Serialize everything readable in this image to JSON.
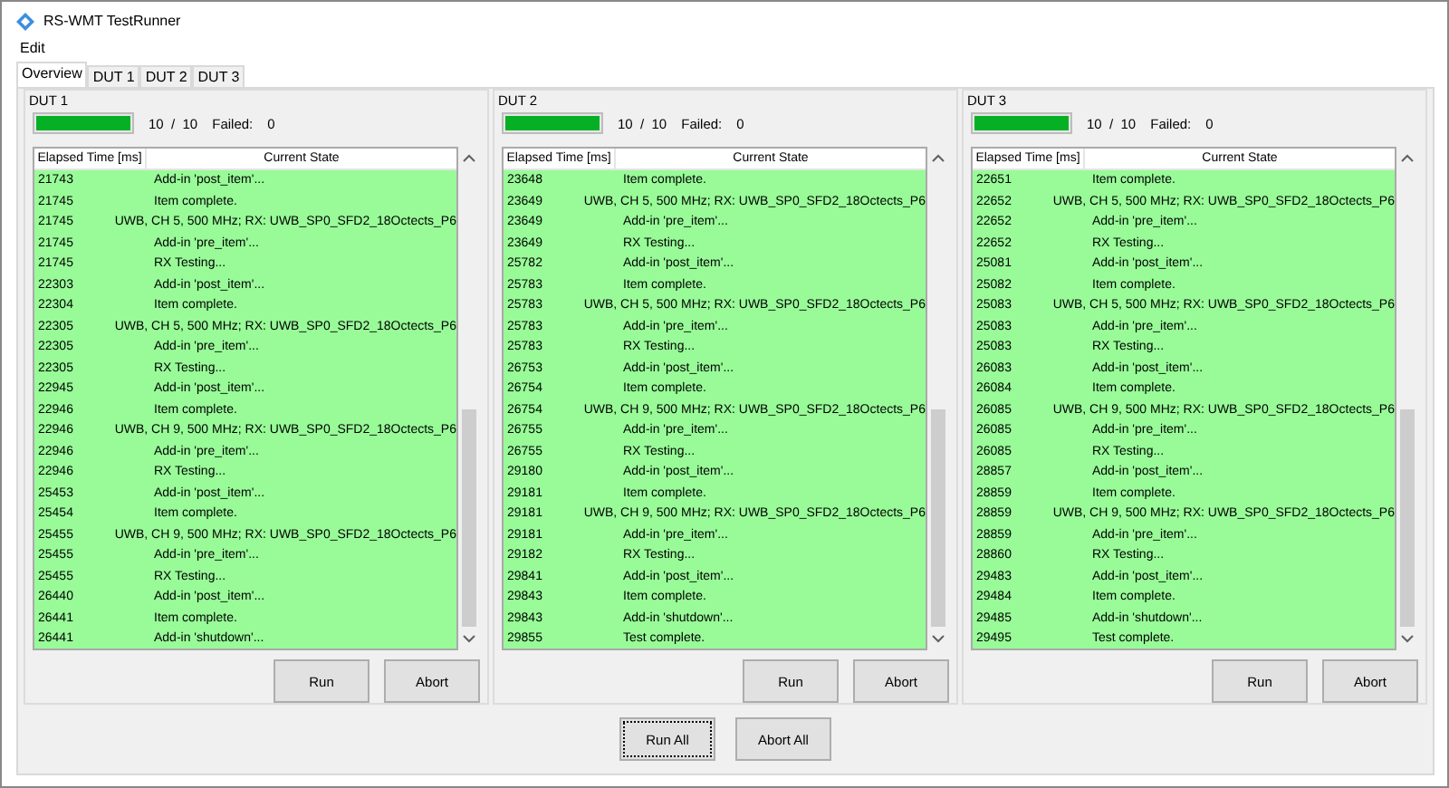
{
  "window": {
    "title": "RS-WMT TestRunner"
  },
  "menu": [
    "Edit"
  ],
  "tabs": [
    {
      "label": "Overview",
      "selected": true
    },
    {
      "label": "DUT 1",
      "selected": false
    },
    {
      "label": "DUT 2",
      "selected": false
    },
    {
      "label": "DUT 3",
      "selected": false
    }
  ],
  "duts": [
    {
      "title": "DUT 1",
      "progress": {
        "level": 1,
        "count": "10  /  10",
        "failed_label": "Failed:",
        "failed": "0"
      },
      "columns": [
        "Elapsed Time [ms]",
        "Current State"
      ],
      "rows": [
        [
          "21743",
          "Add-in 'post_item'..."
        ],
        [
          "21745",
          "Item complete."
        ],
        [
          "21745",
          "UWB, CH 5, 500 MHz; RX: UWB_SP0_SFD2_18Octects_P6"
        ],
        [
          "21745",
          "Add-in 'pre_item'..."
        ],
        [
          "21745",
          "RX Testing..."
        ],
        [
          "22303",
          "Add-in 'post_item'..."
        ],
        [
          "22304",
          "Item complete."
        ],
        [
          "22305",
          "UWB, CH 5, 500 MHz; RX: UWB_SP0_SFD2_18Octects_P6"
        ],
        [
          "22305",
          "Add-in 'pre_item'..."
        ],
        [
          "22305",
          "RX Testing..."
        ],
        [
          "22945",
          "Add-in 'post_item'..."
        ],
        [
          "22946",
          "Item complete."
        ],
        [
          "22946",
          "UWB, CH 9, 500 MHz; RX: UWB_SP0_SFD2_18Octects_P6"
        ],
        [
          "22946",
          "Add-in 'pre_item'..."
        ],
        [
          "22946",
          "RX Testing..."
        ],
        [
          "25453",
          "Add-in 'post_item'..."
        ],
        [
          "25454",
          "Item complete."
        ],
        [
          "25455",
          "UWB, CH 9, 500 MHz; RX: UWB_SP0_SFD2_18Octects_P6"
        ],
        [
          "25455",
          "Add-in 'pre_item'..."
        ],
        [
          "25455",
          "RX Testing..."
        ],
        [
          "26440",
          "Add-in 'post_item'..."
        ],
        [
          "26441",
          "Item complete."
        ],
        [
          "26441",
          "Add-in 'shutdown'..."
        ]
      ],
      "buttons": [
        "Run",
        "Abort"
      ]
    },
    {
      "title": "DUT 2",
      "progress": {
        "level": 1,
        "count": "10  /  10",
        "failed_label": "Failed:",
        "failed": "0"
      },
      "columns": [
        "Elapsed Time [ms]",
        "Current State"
      ],
      "rows": [
        [
          "23648",
          "Item complete."
        ],
        [
          "23649",
          "UWB, CH 5, 500 MHz; RX: UWB_SP0_SFD2_18Octects_P6"
        ],
        [
          "23649",
          "Add-in 'pre_item'..."
        ],
        [
          "23649",
          "RX Testing..."
        ],
        [
          "25782",
          "Add-in 'post_item'..."
        ],
        [
          "25783",
          "Item complete."
        ],
        [
          "25783",
          "UWB, CH 5, 500 MHz; RX: UWB_SP0_SFD2_18Octects_P6"
        ],
        [
          "25783",
          "Add-in 'pre_item'..."
        ],
        [
          "25783",
          "RX Testing..."
        ],
        [
          "26753",
          "Add-in 'post_item'..."
        ],
        [
          "26754",
          "Item complete."
        ],
        [
          "26754",
          "UWB, CH 9, 500 MHz; RX: UWB_SP0_SFD2_18Octects_P6"
        ],
        [
          "26755",
          "Add-in 'pre_item'..."
        ],
        [
          "26755",
          "RX Testing..."
        ],
        [
          "29180",
          "Add-in 'post_item'..."
        ],
        [
          "29181",
          "Item complete."
        ],
        [
          "29181",
          "UWB, CH 9, 500 MHz; RX: UWB_SP0_SFD2_18Octects_P6"
        ],
        [
          "29181",
          "Add-in 'pre_item'..."
        ],
        [
          "29182",
          "RX Testing..."
        ],
        [
          "29841",
          "Add-in 'post_item'..."
        ],
        [
          "29843",
          "Item complete."
        ],
        [
          "29843",
          "Add-in 'shutdown'..."
        ],
        [
          "29855",
          "Test complete."
        ]
      ],
      "buttons": [
        "Run",
        "Abort"
      ]
    },
    {
      "title": "DUT 3",
      "progress": {
        "level": 1,
        "count": "10  /  10",
        "failed_label": "Failed:",
        "failed": "0"
      },
      "columns": [
        "Elapsed Time [ms]",
        "Current State"
      ],
      "rows": [
        [
          "22651",
          "Item complete."
        ],
        [
          "22652",
          "UWB, CH 5, 500 MHz; RX: UWB_SP0_SFD2_18Octects_P6"
        ],
        [
          "22652",
          "Add-in 'pre_item'..."
        ],
        [
          "22652",
          "RX Testing..."
        ],
        [
          "25081",
          "Add-in 'post_item'..."
        ],
        [
          "25082",
          "Item complete."
        ],
        [
          "25083",
          "UWB, CH 5, 500 MHz; RX: UWB_SP0_SFD2_18Octects_P6"
        ],
        [
          "25083",
          "Add-in 'pre_item'..."
        ],
        [
          "25083",
          "RX Testing..."
        ],
        [
          "26083",
          "Add-in 'post_item'..."
        ],
        [
          "26084",
          "Item complete."
        ],
        [
          "26085",
          "UWB, CH 9, 500 MHz; RX: UWB_SP0_SFD2_18Octects_P6"
        ],
        [
          "26085",
          "Add-in 'pre_item'..."
        ],
        [
          "26085",
          "RX Testing..."
        ],
        [
          "28857",
          "Add-in 'post_item'..."
        ],
        [
          "28859",
          "Item complete."
        ],
        [
          "28859",
          "UWB, CH 9, 500 MHz; RX: UWB_SP0_SFD2_18Octects_P6"
        ],
        [
          "28859",
          "Add-in 'pre_item'..."
        ],
        [
          "28860",
          "RX Testing..."
        ],
        [
          "29483",
          "Add-in 'post_item'..."
        ],
        [
          "29484",
          "Item complete."
        ],
        [
          "29485",
          "Add-in 'shutdown'..."
        ],
        [
          "29495",
          "Test complete."
        ]
      ],
      "buttons": [
        "Run",
        "Abort"
      ]
    }
  ],
  "bottom_buttons": [
    {
      "label": "Run All",
      "focused": true
    },
    {
      "label": "Abort All",
      "focused": false
    }
  ]
}
